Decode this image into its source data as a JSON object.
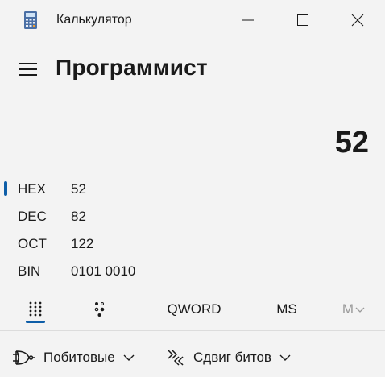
{
  "window": {
    "title": "Калькулятор",
    "icon": "calculator-app-icon",
    "controls": [
      "minimize-icon",
      "maximize-icon",
      "close-icon"
    ]
  },
  "header": {
    "mode_title": "Программист",
    "menu_icon": "hamburger-menu-icon"
  },
  "display": {
    "value": "52"
  },
  "radix": {
    "selected": "HEX",
    "rows": [
      {
        "label": "HEX",
        "value": "52"
      },
      {
        "label": "DEC",
        "value": "82"
      },
      {
        "label": "OCT",
        "value": "122"
      },
      {
        "label": "BIN",
        "value": "0101 0010"
      }
    ]
  },
  "toolbar": {
    "keypad_icon": "full-keypad-icon",
    "bit_toggle_icon": "bit-toggling-keypad-icon",
    "word_size": "QWORD",
    "memory_store": "MS",
    "memory_list": "M"
  },
  "bottom": {
    "bitwise": {
      "label": "Побитовые",
      "icon": "logic-gate-icon"
    },
    "bitshift": {
      "label": "Сдвиг битов",
      "icon": "bit-shift-icon"
    }
  },
  "colors": {
    "accent": "#0e5ea8",
    "background": "#f3f3f3",
    "text": "#1a1a1a",
    "disabled": "#9a9a9a"
  }
}
